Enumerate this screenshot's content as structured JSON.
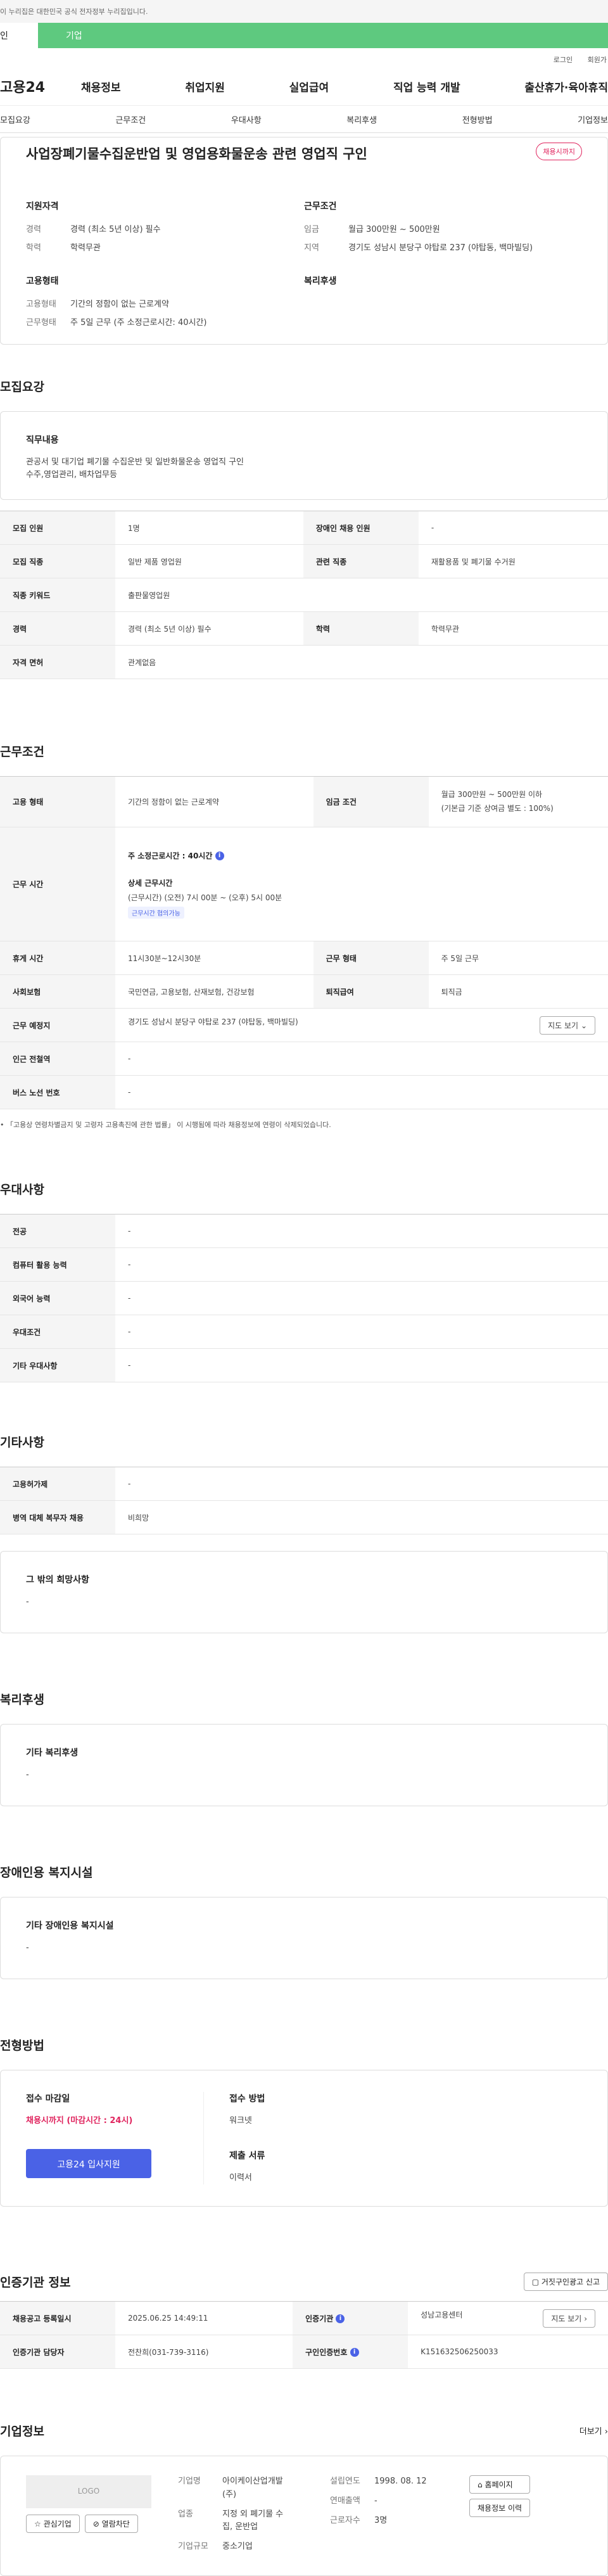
{
  "gov_bar": "이 누리집은 대한민국 공식 전자정부 누리집입니다.",
  "top_tabs": [
    "인",
    "기업"
  ],
  "util": [
    "로그인",
    "회원가"
  ],
  "logo": "고용24",
  "gnb": [
    "채용정보",
    "취업지원",
    "실업급여",
    "직업 능력 개발",
    "출산휴가·육아휴직"
  ],
  "subnav": [
    "모집요강",
    "근무조건",
    "우대사항",
    "복리후생",
    "전형방법",
    "기업정보"
  ],
  "summary": {
    "title": "사업장폐기물수집운반업 및 영업용화물운송 관련 영업직 구인",
    "badge": "채용시까지",
    "req_title": "지원자격",
    "req": [
      {
        "k": "경력",
        "v": "경력 (최소 5년 이상) 필수"
      },
      {
        "k": "학력",
        "v": "학력무관"
      }
    ],
    "cond_title": "근무조건",
    "cond": [
      {
        "k": "임금",
        "v": "월급 300만원 ~ 500만원"
      },
      {
        "k": "지역",
        "v": "경기도 성남시 분당구 야탑로 237 (야탑동, 백마빌딩)"
      }
    ],
    "emp_title": "고용형태",
    "emp": [
      {
        "k": "고용형태",
        "v": "기간의 정함이 없는 근로계약"
      },
      {
        "k": "근무형태",
        "v": "주 5일 근무 (주 소정근로시간: 40시간)"
      }
    ],
    "welfare_title": "복리후생"
  },
  "recruit": {
    "title": "모집요강",
    "job_title": "직무내용",
    "job_desc": "관공서 및 대기업 폐기물 수집운반 및 일반화물운송 영업직 구인\n수주,영업관리, 배차업무등",
    "rows": [
      {
        "k1": "모집 인원",
        "v1": "1명",
        "k2": "장애인 채용 인원",
        "v2": "-"
      },
      {
        "k1": "모집 직종",
        "v1": "일반 제품 영업원",
        "k2": "관련 직종",
        "v2": "재활용품 및 폐기물 수거원"
      },
      {
        "k1": "직종 키워드",
        "v1": "출판물영업원"
      },
      {
        "k1": "경력",
        "v1": "경력 (최소 5년 이상) 필수",
        "k2": "학력",
        "v2": "학력무관"
      },
      {
        "k1": "자격 면허",
        "v1": "관계없음"
      }
    ]
  },
  "work": {
    "title": "근무조건",
    "emp_k": "고용 형태",
    "emp_v": "기간의 정함이 없는 근로계약",
    "wage_k": "임금 조건",
    "wage_v1": "월급 300만원 ~ 500만원 이하",
    "wage_v2": "(기본급 기준 상여금 별도 : 100%)",
    "time_k": "근무 시간",
    "time_weekly": "주 소정근로시간 : 40시간",
    "time_detail_title": "상세 근무시간",
    "time_detail": "(근무시간) (오전) 7시 00분 ~ (오후) 5시 00분",
    "time_tag": "근무시간 협의가능",
    "break_k": "휴게 시간",
    "break_v": "11시30분~12시30분",
    "type_k": "근무 형태",
    "type_v": "주 5일 근무",
    "ins_k": "사회보험",
    "ins_v": "국민연금, 고용보험, 산재보험, 건강보험",
    "ret_k": "퇴직급여",
    "ret_v": "퇴직금",
    "loc_k": "근무 예정지",
    "loc_v": "경기도 성남시 분당구 야탑로 237 (야탑동, 백마빌딩)",
    "map_btn": "지도 보기",
    "sub_k": "인근 전철역",
    "sub_v": "-",
    "bus_k": "버스 노선 번호",
    "bus_v": "-",
    "note": "「고용상 연령차별금지 및 고령자 고용촉진에 관한 법률」 이 시행됨에 따라 채용정보에 연령이 삭제되었습니다."
  },
  "pref": {
    "title": "우대사항",
    "rows": [
      {
        "k": "전공",
        "v": "-"
      },
      {
        "k": "컴퓨터 활용 능력",
        "v": "-"
      },
      {
        "k": "외국어 능력",
        "v": "-"
      },
      {
        "k": "우대조건",
        "v": "-"
      },
      {
        "k": "기타 우대사항",
        "v": "-"
      }
    ]
  },
  "etc": {
    "title": "기타사항",
    "rows": [
      {
        "k": "고용허가제",
        "v": "-"
      },
      {
        "k": "병역 대체 복무자 채용",
        "v": "비희망"
      }
    ],
    "box_title": "그 밖의 희망사항",
    "box_v": "-"
  },
  "welfare": {
    "title": "복리후생",
    "box_title": "기타 복리후생",
    "box_v": "-"
  },
  "disabled": {
    "title": "장애인용 복지시설",
    "box_title": "기타 장애인용 복지시설",
    "box_v": "-"
  },
  "process": {
    "title": "전형방법",
    "deadline_k": "접수 마감일",
    "deadline_v": "채용시까지 (마감시간 : 24시)",
    "apply_btn": "고용24 입사지원",
    "method_k": "접수 방법",
    "method_v": "워크넷",
    "docs_k": "제출 서류",
    "docs_v": "이력서"
  },
  "cert": {
    "title": "인증기관 정보",
    "report_btn": "거짓구인광고 신고",
    "r1k1": "채용공고 등록일시",
    "r1v1": "2025.06.25 14:49:11",
    "r1k2": "인증기관",
    "r1v2": "성남고용센터",
    "r1btn": "지도 보기",
    "r2k1": "인증기관 담당자",
    "r2v1": "전찬희(031-739-3116)",
    "r2k2": "구인인증번호",
    "r2v2": "K151632506250033"
  },
  "company": {
    "title": "기업정보",
    "more": "더보기",
    "logo": "LOGO",
    "fav_btn": "관심기업",
    "block_btn": "열람차단",
    "name_k": "기업명",
    "name_v": "아이케이산업개발(주)",
    "biz_k": "업종",
    "biz_v": "지정 외 폐기물 수집, 운반업",
    "size_k": "기업규모",
    "size_v": "중소기업",
    "est_k": "설립연도",
    "est_v": "1998. 08. 12",
    "sales_k": "연매출액",
    "sales_v": "-",
    "emp_k": "근로자수",
    "emp_v": "3명",
    "home_btn": "홈페이지",
    "hist_btn": "채용정보 이력"
  },
  "colors": {
    "accent": "#4a62e6",
    "brand_green": "#5ec97f",
    "red": "#e0245e"
  }
}
